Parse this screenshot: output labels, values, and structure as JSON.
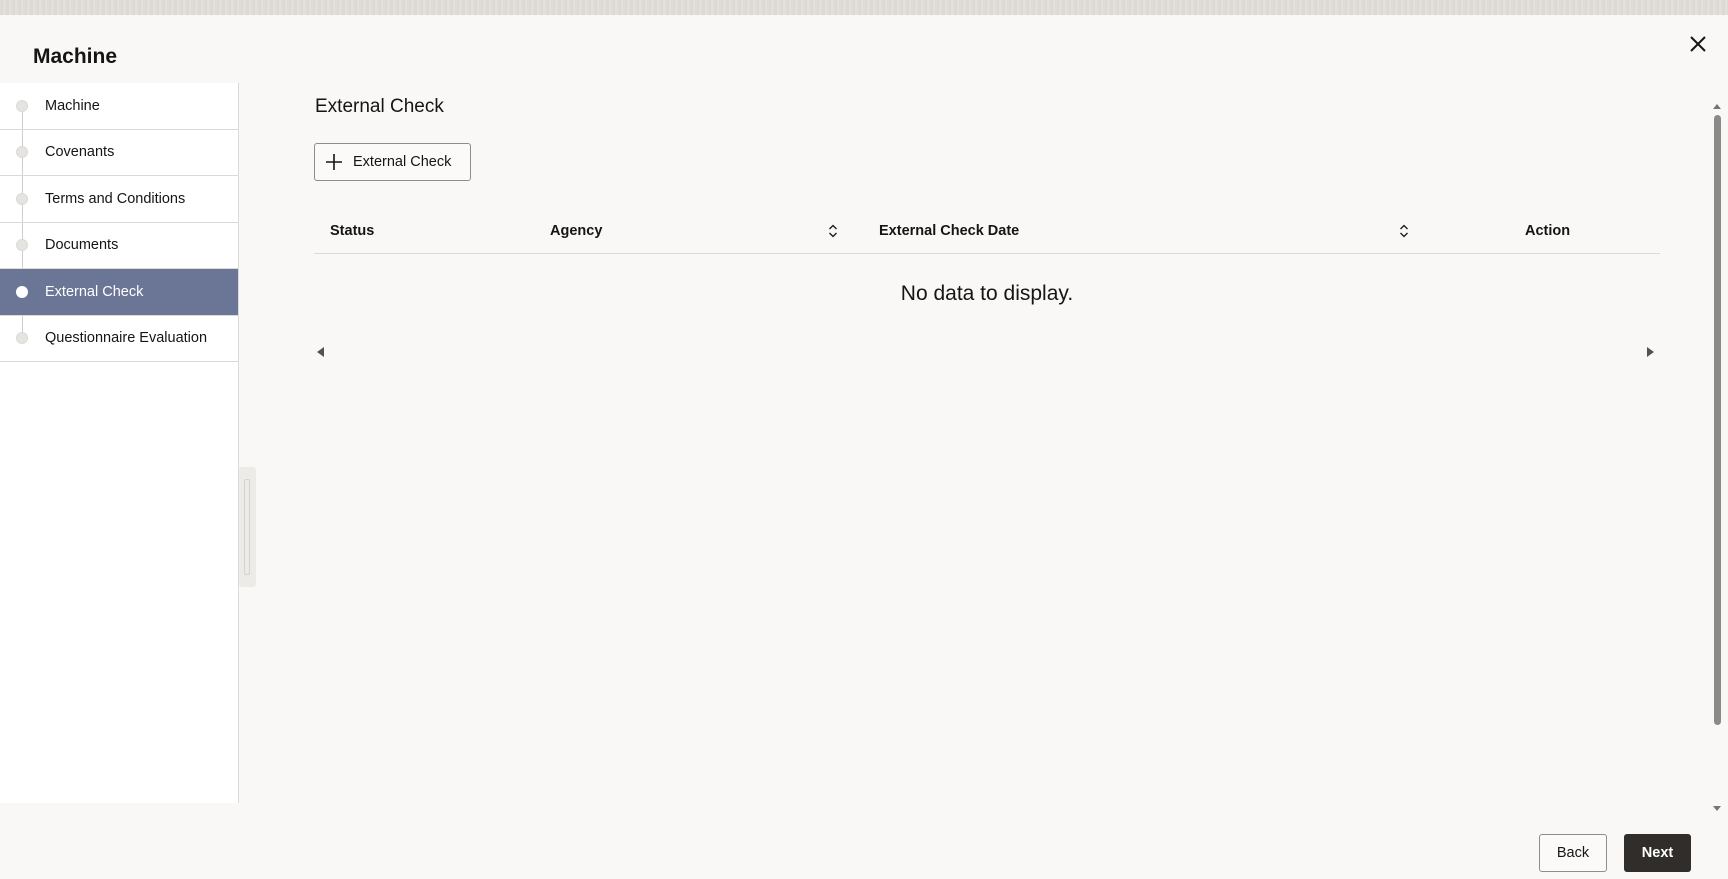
{
  "dialog": {
    "title": "Machine"
  },
  "sidebar": {
    "items": [
      {
        "label": "Machine",
        "active": false
      },
      {
        "label": "Covenants",
        "active": false
      },
      {
        "label": "Terms and Conditions",
        "active": false
      },
      {
        "label": "Documents",
        "active": false
      },
      {
        "label": "External Check",
        "active": true
      },
      {
        "label": "Questionnaire Evaluation",
        "active": false
      }
    ]
  },
  "main": {
    "section_title": "External Check",
    "add_button_label": "External Check",
    "table": {
      "columns": [
        "Status",
        "Agency",
        "External Check Date",
        "Action"
      ],
      "empty_message": "No data to display."
    }
  },
  "footer": {
    "back_label": "Back",
    "next_label": "Next"
  },
  "icons": {
    "close": "close-icon",
    "add": "plus-icon",
    "sort": "sort-icon",
    "scroll_left": "caret-left-icon",
    "scroll_right": "caret-right-icon"
  },
  "colors": {
    "active_nav": "#6b7696",
    "primary_button": "#312d2a"
  }
}
